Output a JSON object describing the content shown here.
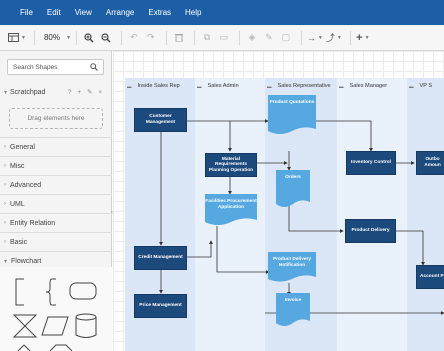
{
  "menubar": {
    "items": [
      "File",
      "Edit",
      "View",
      "Arrange",
      "Extras",
      "Help"
    ]
  },
  "toolbar": {
    "zoom": "80%"
  },
  "sidebar": {
    "search_placeholder": "Search Shapes",
    "scratchpad_label": "Scratchpad",
    "scratchpad_icons": "? + ✎ ×",
    "drop_hint": "Drag elements here",
    "sections": [
      "General",
      "Misc",
      "Advanced",
      "UML",
      "Entity Relation",
      "Basic",
      "Flowchart"
    ]
  },
  "diagram": {
    "lanes": [
      "Inside Sales Rep",
      "Sales Admin",
      "Sales Representative",
      "Sales Manager",
      "VP S"
    ],
    "shapes": {
      "customer_management": "Customer Management",
      "material_requirements": "Material Requirements Planning Operation",
      "facilities_procurement": "Facilities Procurement Application",
      "credit_management": "Credit Management",
      "price_management": "Price Management",
      "product_quotations": "Product Quotations",
      "orders": "Orders",
      "product_delivery_notification": "Product Delivery Notification",
      "invoice": "Invoice",
      "inventory_control": "Inventory Control",
      "product_delivery": "Product Delivery",
      "outbound_amount": "Outbo Amoun",
      "account_p": "Account P"
    },
    "colors": {
      "lane_dark": "#dbe7f6",
      "lane_light": "#e9f1fb",
      "process": "#1d4a7d",
      "document": "#56a8e0"
    }
  }
}
